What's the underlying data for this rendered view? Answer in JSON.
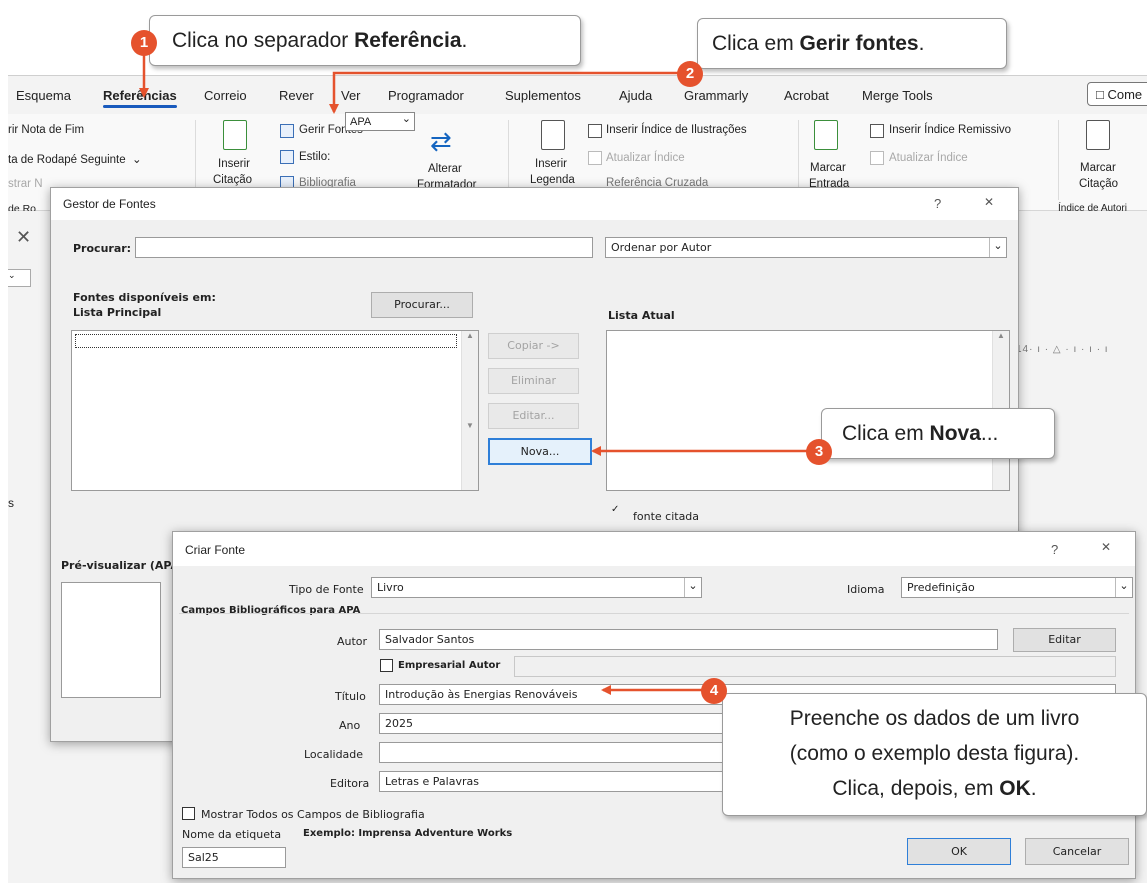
{
  "callouts": {
    "c1": {
      "number": "1",
      "pre": "Clica no separador ",
      "bold": "Referência",
      "post": "."
    },
    "c2": {
      "number": "2",
      "pre": "Clica em ",
      "bold": "Gerir fontes",
      "post": "."
    },
    "c3": {
      "number": "3",
      "pre": "Clica em ",
      "bold": "Nova",
      "post": "..."
    },
    "c4": {
      "number": "4",
      "line1": "Preenche os dados de um livro",
      "line2": "(como o exemplo desta figura).",
      "line3_pre": "Clica, depois, em ",
      "line3_bold": "OK",
      "line3_post": "."
    }
  },
  "ribbon": {
    "tabs": [
      "Esquema",
      "Referências",
      "Correio",
      "Rever",
      "Ver",
      "Programador",
      "Suplementos",
      "Ajuda",
      "Grammarly",
      "Acrobat",
      "Merge Tools"
    ],
    "active_tab": "Referências",
    "comments_button": "Come",
    "footnotes": {
      "insert_endnote": "rir Nota de Fim",
      "next_footnote": "ta de Rodapé Seguinte",
      "show_notes": "strar N",
      "group": "de Ro"
    },
    "citations": {
      "insert_citation": "Inserir",
      "insert_citation_2": "Citação",
      "manage_sources": "Gerir Fontes",
      "style_label": "Estilo:",
      "style_value": "APA",
      "bibliography": "Bibliografia"
    },
    "switch": {
      "label": "Alterar",
      "label2": "Formatador"
    },
    "captions": {
      "insert_caption": "Inserir",
      "insert_caption_2": "Legenda",
      "insert_table_of_figures": "Inserir Índice de Ilustrações",
      "update_table": "Atualizar Índice",
      "cross_reference": "Referência Cruzada"
    },
    "index": {
      "mark_entry": "Marcar",
      "mark_entry_2": "Entrada",
      "insert_index": "Inserir Índice Remissivo",
      "update_index": "Atualizar Índice"
    },
    "authorities": {
      "mark_citation": "Marcar",
      "mark_citation_2": "Citação",
      "group": "Índice de Autori"
    },
    "ruler": "14· ı · △ · ı · ı · ı"
  },
  "source_manager": {
    "title": "Gestor de Fontes",
    "help": "?",
    "close": "✕",
    "search_label": "Procurar:",
    "search_value": "",
    "sort_value": "Ordenar por Autor",
    "available_in": "Fontes disponíveis em:",
    "master_list": "Lista Principal",
    "browse_button": "Procurar...",
    "current_list": "Lista Atual",
    "copy_button": "Copiar ->",
    "delete_button": "Eliminar",
    "edit_button": "Editar...",
    "new_button": "Nova...",
    "cited_note": "fonte citada",
    "preview_label": "Pré-visualizar (APA):"
  },
  "create_source": {
    "title": "Criar Fonte",
    "help": "?",
    "close": "✕",
    "type_label": "Tipo de Fonte",
    "type_value": "Livro",
    "language_label": "Idioma",
    "language_value": "Predefinição",
    "group_label": "Campos Bibliográficos para APA",
    "author_label": "Autor",
    "author_value": "Salvador Santos",
    "edit_button": "Editar",
    "corporate_label": "Empresarial Autor",
    "title_label": "Título",
    "title_value": "Introdução às Energias Renováveis",
    "year_label": "Ano",
    "year_value": "2025",
    "city_label": "Localidade",
    "city_value": "",
    "publisher_label": "Editora",
    "publisher_value": "Letras e Palavras",
    "show_all_label": "Mostrar Todos os Campos de Bibliografia",
    "tag_label": "Nome da etiqueta",
    "example_text": "Exemplo: Imprensa Adventure Works",
    "tag_value": "Sal25",
    "ok_button": "OK",
    "cancel_button": "Cancelar"
  },
  "colors": {
    "accent": "#e5522d",
    "ribbon_blue": "#185abd"
  }
}
